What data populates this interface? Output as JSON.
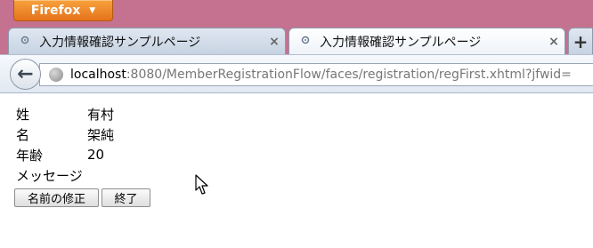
{
  "app": {
    "menu_button": "Firefox",
    "menu_arrow": "▼"
  },
  "tabs": [
    {
      "title": "入力情報確認サンプルページ",
      "close": "×"
    },
    {
      "title": "入力情報確認サンプルページ",
      "close": "×"
    }
  ],
  "new_tab": "+",
  "nav": {
    "back": "←",
    "url_host": "localhost",
    "url_rest": ":8080/MemberRegistrationFlow/faces/registration/regFirst.xhtml?jfwid="
  },
  "form": {
    "rows": [
      {
        "label": "姓",
        "value": "有村"
      },
      {
        "label": "名",
        "value": "架純"
      },
      {
        "label": "年齢",
        "value": "20"
      },
      {
        "label": "メッセージ",
        "value": ""
      }
    ],
    "edit_name_button": "名前の修正",
    "finish_button": "終了"
  },
  "colors": {
    "titlebar": "#c4728f",
    "firefox_button": "#e5731c"
  }
}
